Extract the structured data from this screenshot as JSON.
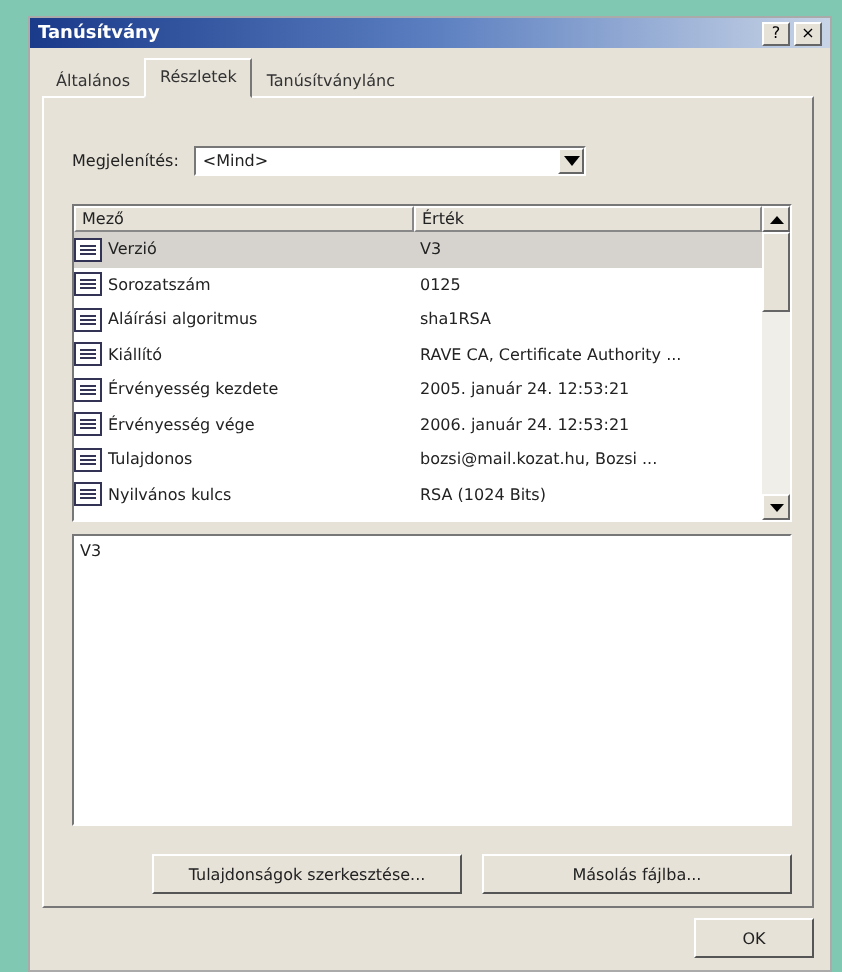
{
  "window": {
    "title": "Tanúsítvány",
    "buttons": [
      "?",
      "×"
    ]
  },
  "tabs": [
    {
      "label": "Általános",
      "selected": false
    },
    {
      "label": "Részletek",
      "selected": true
    },
    {
      "label": "Tanúsítványlánc",
      "selected": false
    }
  ],
  "show": {
    "label": "Megjelenítés:",
    "value": "<Mind>"
  },
  "table": {
    "columns": [
      "Mező",
      "Érték"
    ],
    "rows": [
      {
        "field": "Verzió",
        "value": "V3",
        "selected": true
      },
      {
        "field": "Sorozatszám",
        "value": "0125",
        "selected": false
      },
      {
        "field": "Aláírási algoritmus",
        "value": "sha1RSA",
        "selected": false
      },
      {
        "field": "Kiállító",
        "value": "RAVE CA, Certificate Authority ...",
        "selected": false
      },
      {
        "field": "Érvényesség kezdete",
        "value": "2005. január 24. 12:53:21",
        "selected": false
      },
      {
        "field": "Érvényesség vége",
        "value": "2006. január 24. 12:53:21",
        "selected": false
      },
      {
        "field": "Tulajdonos",
        "value": "bozsi@mail.kozat.hu, Bozsi ...",
        "selected": false
      },
      {
        "field": "Nyilvános kulcs",
        "value": "RSA (1024 Bits)",
        "selected": false
      }
    ]
  },
  "detail": "V3",
  "buttons": [
    "Tulajdonságok szerkesztése...",
    "Másolás fájlba..."
  ],
  "ok": "OK"
}
